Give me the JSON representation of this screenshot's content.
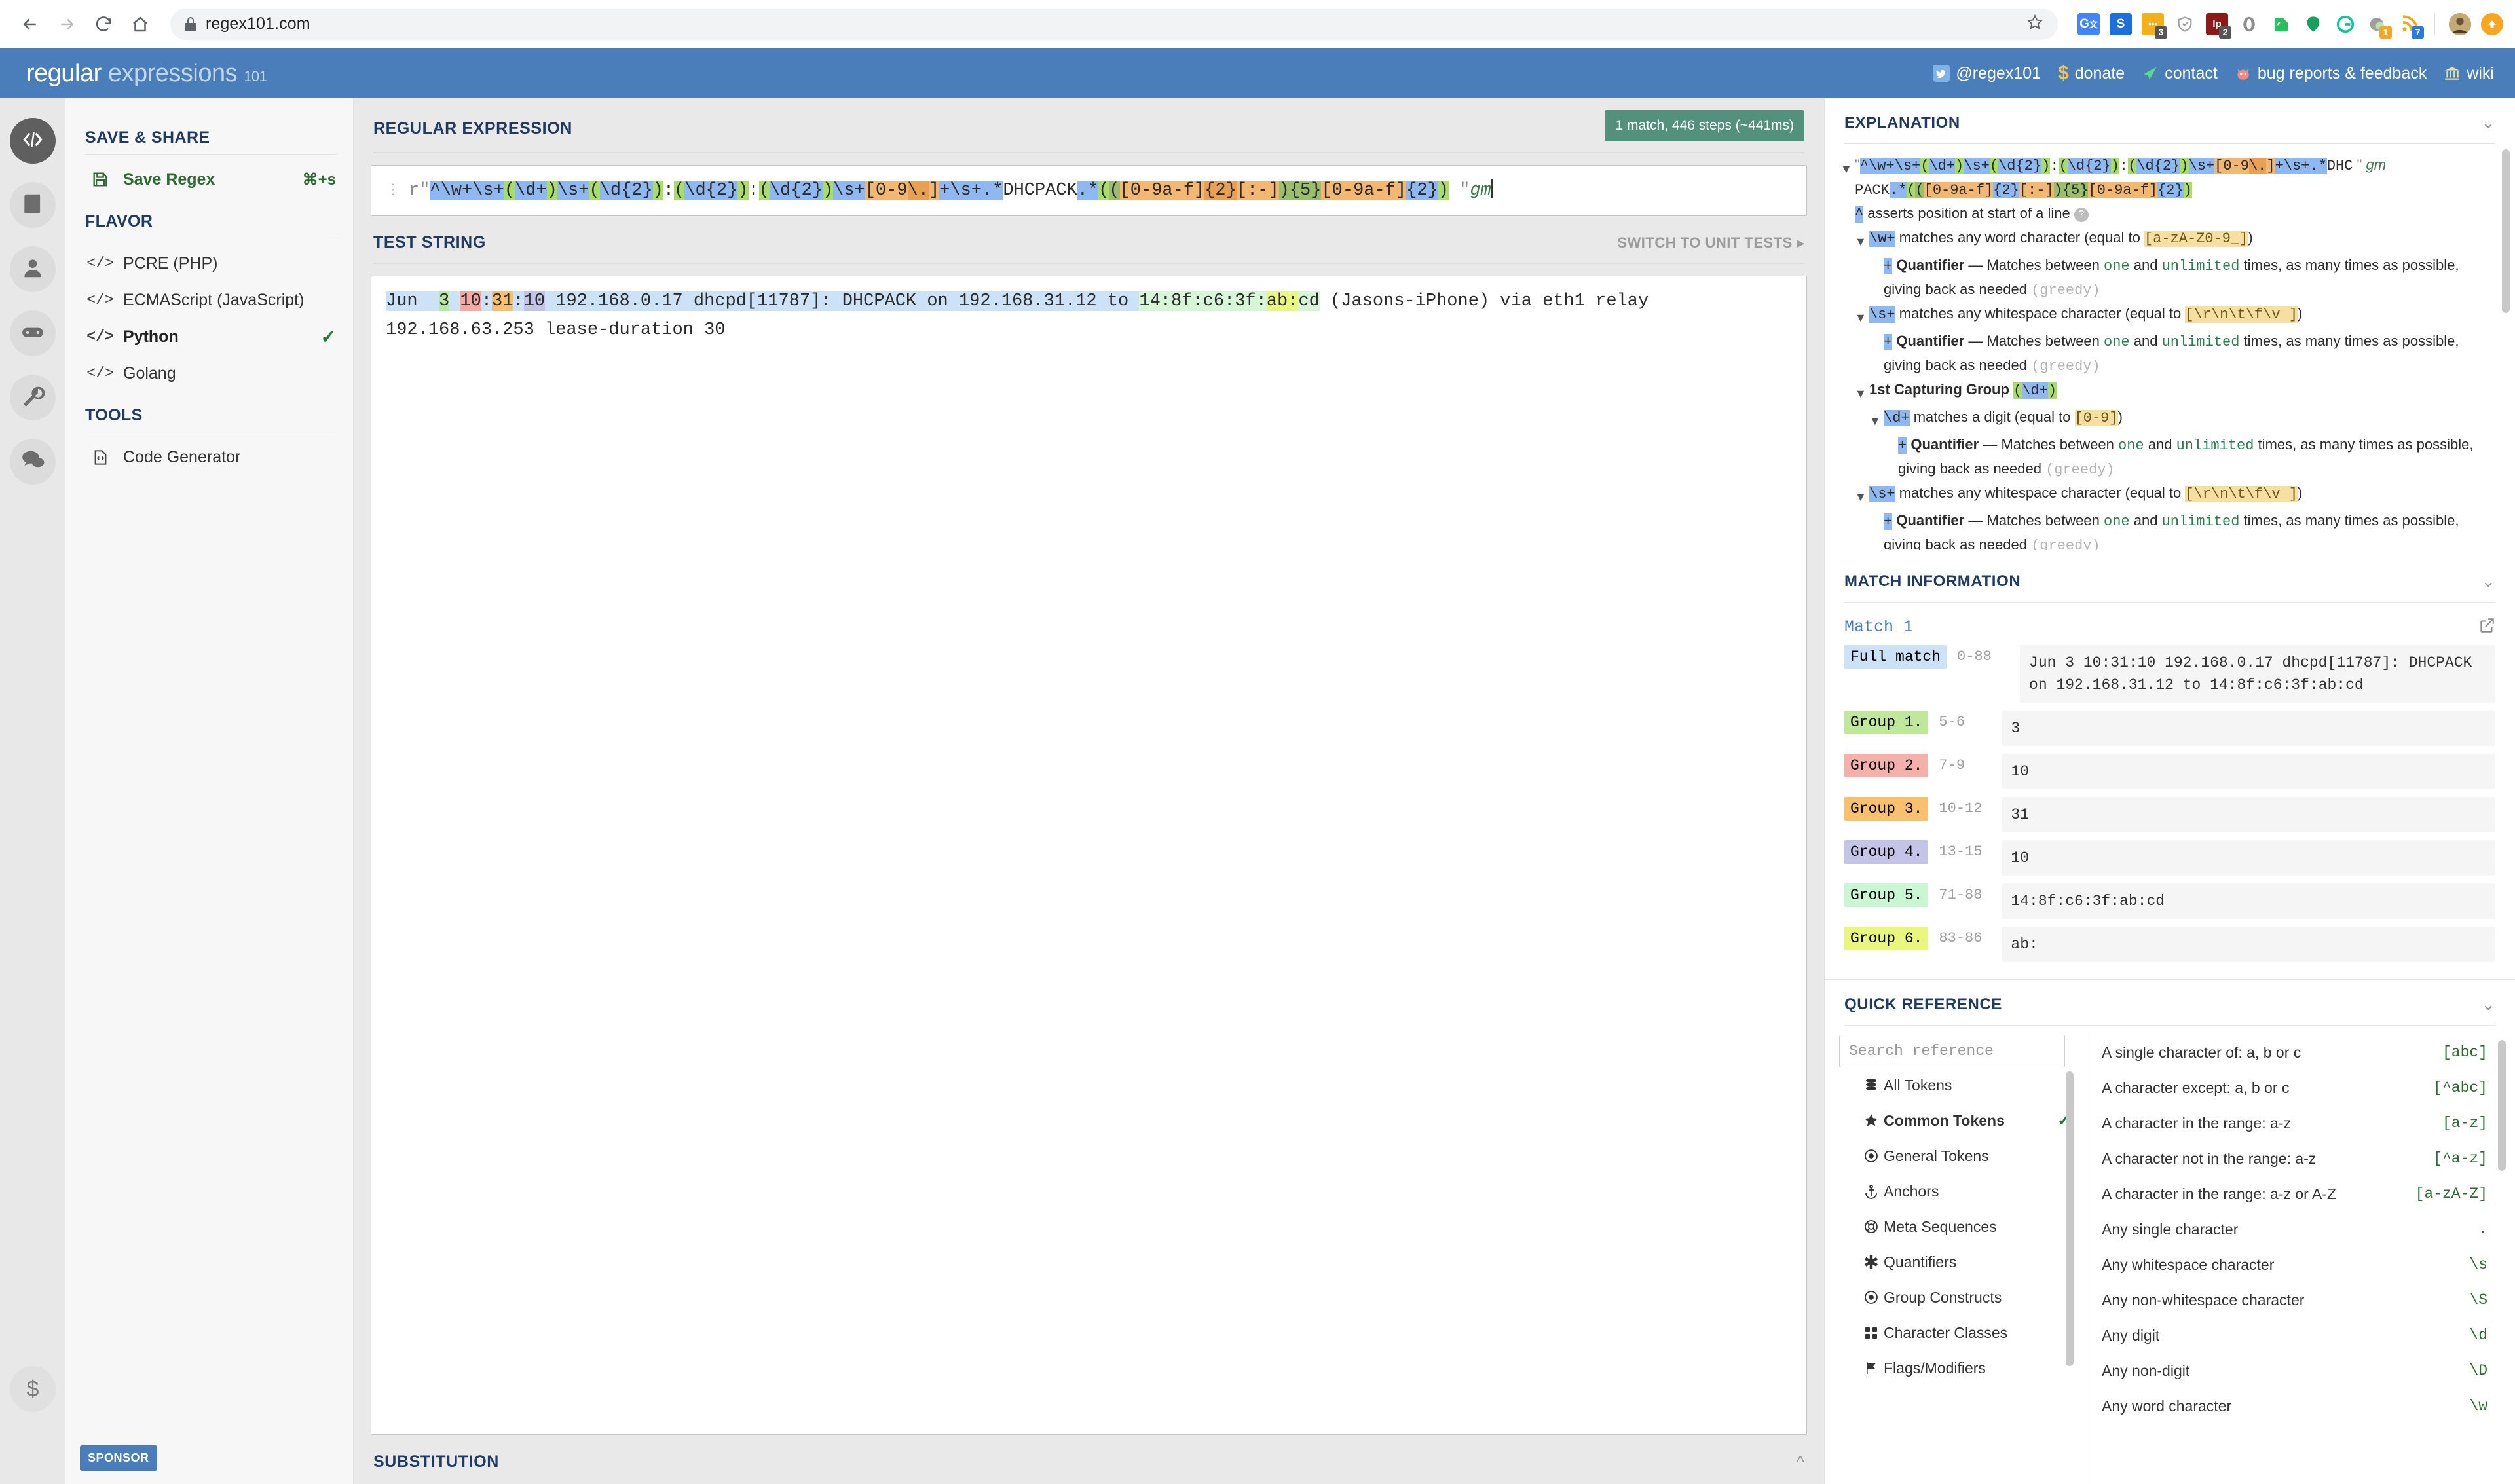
{
  "browser": {
    "url": "regex101.com",
    "nav": {
      "back": "back-arrow",
      "forward": "forward-arrow",
      "reload": "reload",
      "home": "home"
    },
    "extensions": [
      {
        "name": "google-translate",
        "glyph": "G",
        "color": "#ffffff",
        "badge": ""
      },
      {
        "name": "scribd",
        "glyph": "S",
        "color": "#1e6fd9",
        "badge": ""
      },
      {
        "name": "notes",
        "glyph": "●●●",
        "color": "#f2b01e",
        "badge": "3"
      },
      {
        "name": "shield-check",
        "glyph": "✓",
        "color": "#9e9e9e",
        "badge": ""
      },
      {
        "name": "lastpass",
        "glyph": "lp",
        "color": "#8b1a1a",
        "badge": "2"
      },
      {
        "name": "opera-o",
        "glyph": "O",
        "color": "#9e9e9e",
        "badge": ""
      },
      {
        "name": "evernote",
        "glyph": "E",
        "color": "#2dbe60",
        "badge": ""
      },
      {
        "name": "evernote-clip",
        "glyph": "",
        "color": "#17a05a",
        "badge": ""
      },
      {
        "name": "grammarly",
        "glyph": "G",
        "color": "#15c39a",
        "badge": ""
      },
      {
        "name": "pocket",
        "glyph": "",
        "color": "#9e9e9e",
        "badge": "1"
      },
      {
        "name": "rss-feed",
        "glyph": "◔",
        "color": "#f5a623",
        "badge": "7"
      }
    ],
    "profile": "avatar",
    "menu": "orange-arrow"
  },
  "header": {
    "logo_main": "regular",
    "logo_sub": "expressions",
    "logo_num": "101",
    "links": [
      {
        "icon": "twitter-icon",
        "label": "@regex101"
      },
      {
        "icon": "dollar-icon",
        "label": "donate"
      },
      {
        "icon": "paper-plane-icon",
        "label": "contact"
      },
      {
        "icon": "bug-icon",
        "label": "bug reports & feedback"
      },
      {
        "icon": "bank-icon",
        "label": "wiki"
      }
    ]
  },
  "rail": [
    {
      "name": "regex-editor",
      "icon": "code-icon",
      "active": true
    },
    {
      "name": "library",
      "icon": "book-icon",
      "active": false
    },
    {
      "name": "account",
      "icon": "user-icon",
      "active": false
    },
    {
      "name": "regex-quiz",
      "icon": "gamepad-icon",
      "active": false
    },
    {
      "name": "tools",
      "icon": "wrench-icon",
      "active": false
    },
    {
      "name": "community",
      "icon": "chat-icon",
      "active": false
    },
    {
      "name": "sponsor",
      "icon": "dollar-icon",
      "active": false
    }
  ],
  "sidebar": {
    "sections": [
      {
        "title": "SAVE & SHARE",
        "items": [
          {
            "label": "Save Regex",
            "icon": "save-icon",
            "shortcut": "⌘+s",
            "green": true,
            "selected": false
          }
        ]
      },
      {
        "title": "FLAVOR",
        "items": [
          {
            "label": "PCRE (PHP)",
            "icon": "code-icon",
            "shortcut": "",
            "green": false,
            "selected": false
          },
          {
            "label": "ECMAScript (JavaScript)",
            "icon": "code-icon",
            "shortcut": "",
            "green": false,
            "selected": false
          },
          {
            "label": "Python",
            "icon": "code-icon",
            "shortcut": "",
            "green": false,
            "selected": true
          },
          {
            "label": "Golang",
            "icon": "code-icon",
            "shortcut": "",
            "green": false,
            "selected": false
          }
        ]
      },
      {
        "title": "TOOLS",
        "items": [
          {
            "label": "Code Generator",
            "icon": "file-code-icon",
            "shortcut": "",
            "green": false,
            "selected": false
          }
        ]
      }
    ],
    "sponsor_label": "SPONSOR"
  },
  "regex_panel": {
    "title": "REGULAR EXPRESSION",
    "match_chip": "1 match, 446 steps (~441ms)",
    "prefix": "r\"",
    "suffix": "\"",
    "flags": "gm",
    "pattern": "^\\w+\\s+(\\d+)\\s+(\\d{2}):(\\d{2}):(\\d{2})\\s+[0-9\\.]+\\s+.*DHCPACK.*(([0-9a-f]{2}[:-]){5}[0-9a-f]{2})"
  },
  "test_panel": {
    "title": "TEST STRING",
    "switch_label": "SWITCH TO UNIT TESTS",
    "line1_a": "Jun  ",
    "line1_b": "3",
    "line1_c": " ",
    "line1_d": "10",
    "line1_e": ":",
    "line1_f": "31",
    "line1_g": ":",
    "line1_h": "10",
    "line1_i": " 192.168.0.17 dhcpd[11787]: DHCPACK on 192.168.31.12 to ",
    "line1_j": "14:8f:c6:3f:",
    "line1_k": "ab:",
    "line1_l": "cd",
    "line1_m": " (Jasons-iPhone) via eth1 relay 192.168.63.253 lease-duration 30",
    "full_text": "Jun  3 10:31:10 192.168.0.17 dhcpd[11787]: DHCPACK on 192.168.31.12 to 14:8f:c6:3f:ab:cd (Jasons-iPhone) via eth1 relay 192.168.63.253 lease-duration 30"
  },
  "substitution_panel": {
    "title": "SUBSTITUTION"
  },
  "explanation": {
    "title": "EXPLANATION",
    "pattern_line1": "^\\w+\\s+(\\d+)\\s+(\\d{2}):(\\d{2}):(\\d{2})\\s+[0-9\\.]+\\s+.*DHC",
    "pattern_line2": "PACK.*(([0-9a-f]{2}[:-]){5}[0-9a-f]{2})",
    "flags": "gm",
    "entries": [
      {
        "token": "^",
        "text": "asserts position at start of a line",
        "help": true,
        "indent": 0,
        "tri": false
      },
      {
        "token": "\\w+",
        "text": "matches any word character (equal to",
        "code": "[a-zA-Z0-9_]",
        "tail": ")",
        "indent": 1,
        "tri": true
      },
      {
        "token": "+",
        "bold": "Quantifier",
        "text": "— Matches between",
        "w1": "one",
        "mid": "and",
        "w2": "unlimited",
        "tail2": "times, as many times as possible, giving back as needed",
        "grey": "(greedy)",
        "indent": 2,
        "tri": false
      },
      {
        "token": "\\s+",
        "text": "matches any whitespace character (equal to",
        "code": "[\\r\\n\\t\\f\\v ]",
        "tail": ")",
        "indent": 1,
        "tri": true
      },
      {
        "token": "+",
        "bold": "Quantifier",
        "text": "— Matches between",
        "w1": "one",
        "mid": "and",
        "w2": "unlimited",
        "tail2": "times, as many times as possible, giving back as needed",
        "grey": "(greedy)",
        "indent": 2,
        "tri": false
      },
      {
        "group_title": "1st Capturing Group",
        "group_token": "(\\d+)",
        "indent": 1,
        "tri": true
      },
      {
        "token": "\\d+",
        "text": "matches a digit (equal to",
        "code": "[0-9]",
        "tail": ")",
        "indent": 2,
        "tri": true
      },
      {
        "token": "+",
        "bold": "Quantifier",
        "text": "— Matches between",
        "w1": "one",
        "mid": "and",
        "w2": "unlimited",
        "tail2": "times, as many times as possible, giving back as needed",
        "grey": "(greedy)",
        "indent": 3,
        "tri": false
      },
      {
        "token": "\\s+",
        "text": "matches any whitespace character (equal to",
        "code": "[\\r\\n\\t\\f\\v ]",
        "tail": ")",
        "indent": 1,
        "tri": true
      },
      {
        "token": "+",
        "bold": "Quantifier",
        "text": "— Matches between",
        "w1": "one",
        "mid": "and",
        "w2": "unlimited",
        "tail2": "times, as many times as possible, giving back as needed",
        "grey": "(greedy)",
        "indent": 2,
        "tri": false
      }
    ]
  },
  "match_information": {
    "title": "MATCH INFORMATION",
    "match_label": "Match 1",
    "export_icon": "export-icon",
    "rows": [
      {
        "tag": "Full match",
        "range": "0-88",
        "value": "Jun  3 10:31:10 192.168.0.17 dhcpd[11787]: DHCPACK on 192.168.31.12 to 14:8f:c6:3f:ab:cd",
        "color": "c-fullmatch"
      },
      {
        "tag": "Group 1.",
        "range": "5-6",
        "value": "3",
        "color": "c-g1"
      },
      {
        "tag": "Group 2.",
        "range": "7-9",
        "value": "10",
        "color": "c-g2"
      },
      {
        "tag": "Group 3.",
        "range": "10-12",
        "value": "31",
        "color": "c-g3"
      },
      {
        "tag": "Group 4.",
        "range": "13-15",
        "value": "10",
        "color": "c-g4"
      },
      {
        "tag": "Group 5.",
        "range": "71-88",
        "value": "14:8f:c6:3f:ab:cd",
        "color": "c-g5"
      },
      {
        "tag": "Group 6.",
        "range": "83-86",
        "value": "ab:",
        "color": "c-g6"
      }
    ]
  },
  "quick_reference": {
    "title": "QUICK REFERENCE",
    "search_placeholder": "Search reference",
    "categories": [
      {
        "label": "All Tokens",
        "icon": "database-icon",
        "selected": false
      },
      {
        "label": "Common Tokens",
        "icon": "star-icon",
        "selected": true
      },
      {
        "label": "General Tokens",
        "icon": "target-icon",
        "selected": false
      },
      {
        "label": "Anchors",
        "icon": "anchor-icon",
        "selected": false
      },
      {
        "label": "Meta Sequences",
        "icon": "lifebuoy-icon",
        "selected": false
      },
      {
        "label": "Quantifiers",
        "icon": "asterisk-icon",
        "selected": false
      },
      {
        "label": "Group Constructs",
        "icon": "target-icon",
        "selected": false
      },
      {
        "label": "Character Classes",
        "icon": "grid-icon",
        "selected": false
      },
      {
        "label": "Flags/Modifiers",
        "icon": "flag-icon",
        "selected": false
      }
    ],
    "entries": [
      {
        "desc": "A single character of: a, b or c",
        "code": "[abc]"
      },
      {
        "desc": "A character except: a, b or c",
        "code": "[^abc]"
      },
      {
        "desc": "A character in the range: a-z",
        "code": "[a-z]"
      },
      {
        "desc": "A character not in the range: a-z",
        "code": "[^a-z]"
      },
      {
        "desc": "A character in the range: a-z or A-Z",
        "code": "[a-zA-Z]"
      },
      {
        "desc": "Any single character",
        "code": "."
      },
      {
        "desc": "Any whitespace character",
        "code": "\\s"
      },
      {
        "desc": "Any non-whitespace character",
        "code": "\\S"
      },
      {
        "desc": "Any digit",
        "code": "\\d"
      },
      {
        "desc": "Any non-digit",
        "code": "\\D"
      },
      {
        "desc": "Any word character",
        "code": "\\w"
      }
    ]
  },
  "colors": {
    "brand_blue": "#4a7ebb",
    "match_green": "#53917c",
    "heading_navy": "#1f3b63",
    "accent_green": "#2d6b33"
  }
}
